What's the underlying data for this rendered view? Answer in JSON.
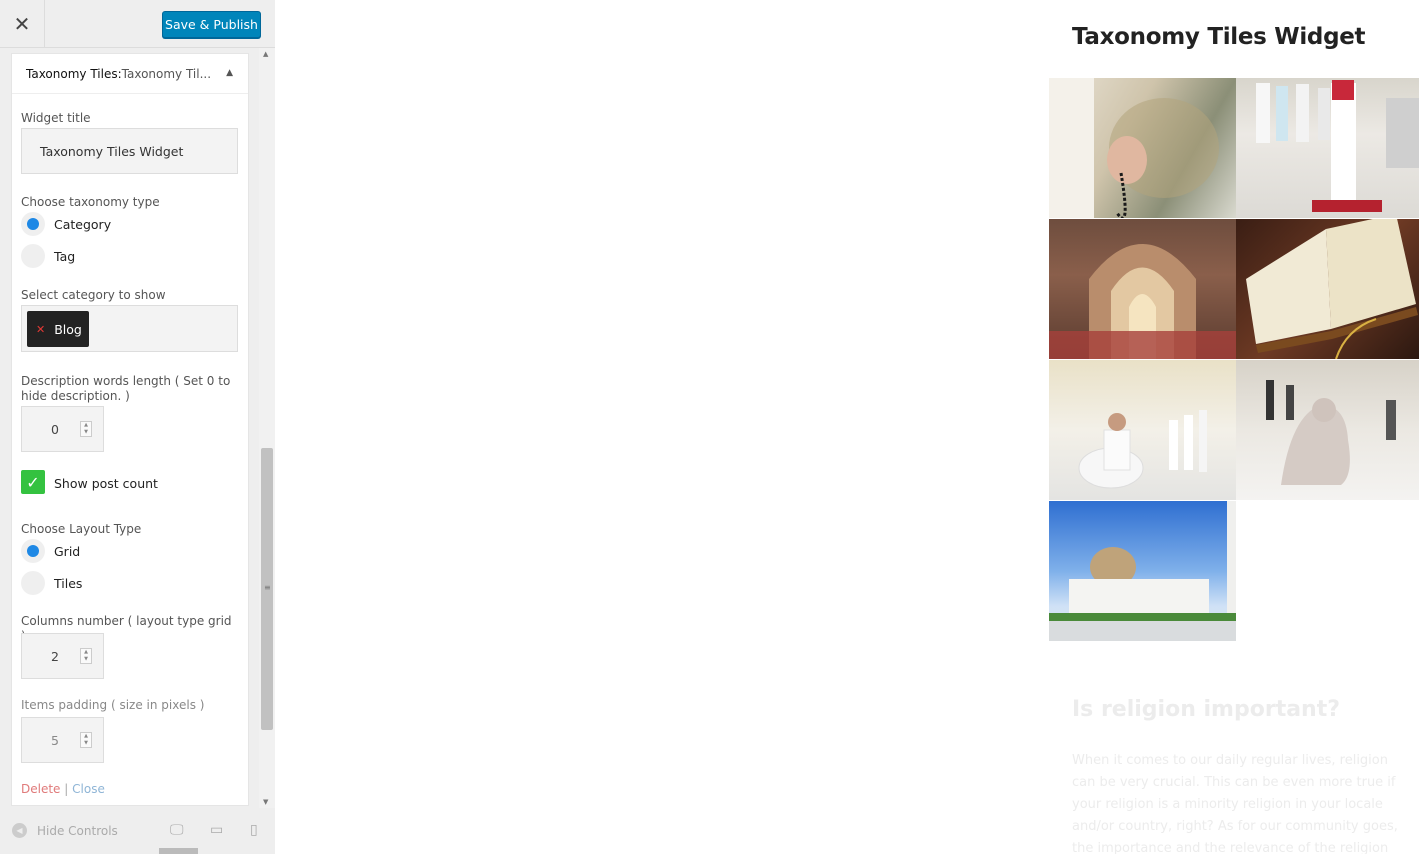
{
  "toolbar": {
    "close_icon": "close-icon",
    "publish_label": "Save & Publish"
  },
  "widget": {
    "header_name": "Taxonomy Tiles:",
    "header_title": " Taxonomy Til...",
    "title_label": "Widget title",
    "title_value": "Taxonomy Tiles Widget",
    "taxonomy_label": "Choose taxonomy type",
    "taxonomy_options": [
      "Category",
      "Tag"
    ],
    "taxonomy_selected": "Category",
    "category_label": "Select category to show",
    "category_chip": "Blog",
    "desc_label": "Description words length ( Set 0 to hide description. )",
    "desc_value": "0",
    "show_count_label": "Show post count",
    "show_count_checked": true,
    "layout_label": "Choose Layout Type",
    "layout_options": [
      "Grid",
      "Tiles"
    ],
    "layout_selected": "Grid",
    "columns_label": "Columns number ( layout type grid )",
    "columns_value": "2",
    "padding_label": "Items padding ( size in pixels )",
    "padding_value": "5",
    "delete_label": "Delete",
    "separator": "|",
    "close_label": "Close"
  },
  "footer": {
    "hide_controls": "Hide Controls"
  },
  "preview": {
    "title": "Taxonomy Tiles Widget",
    "section_title": "Is religion important?",
    "section_text": "When it comes to our daily regular lives, religion can be very crucial. This can be even more true if your religion is a minority religion in your locale and/or country, right? As for our community goes, the importance and the relevance of the religion the..."
  },
  "colors": {
    "accent": "#0085ba",
    "radio_on": "#1e88e5",
    "checkbox": "#34c240",
    "link": "#e07a7a"
  }
}
